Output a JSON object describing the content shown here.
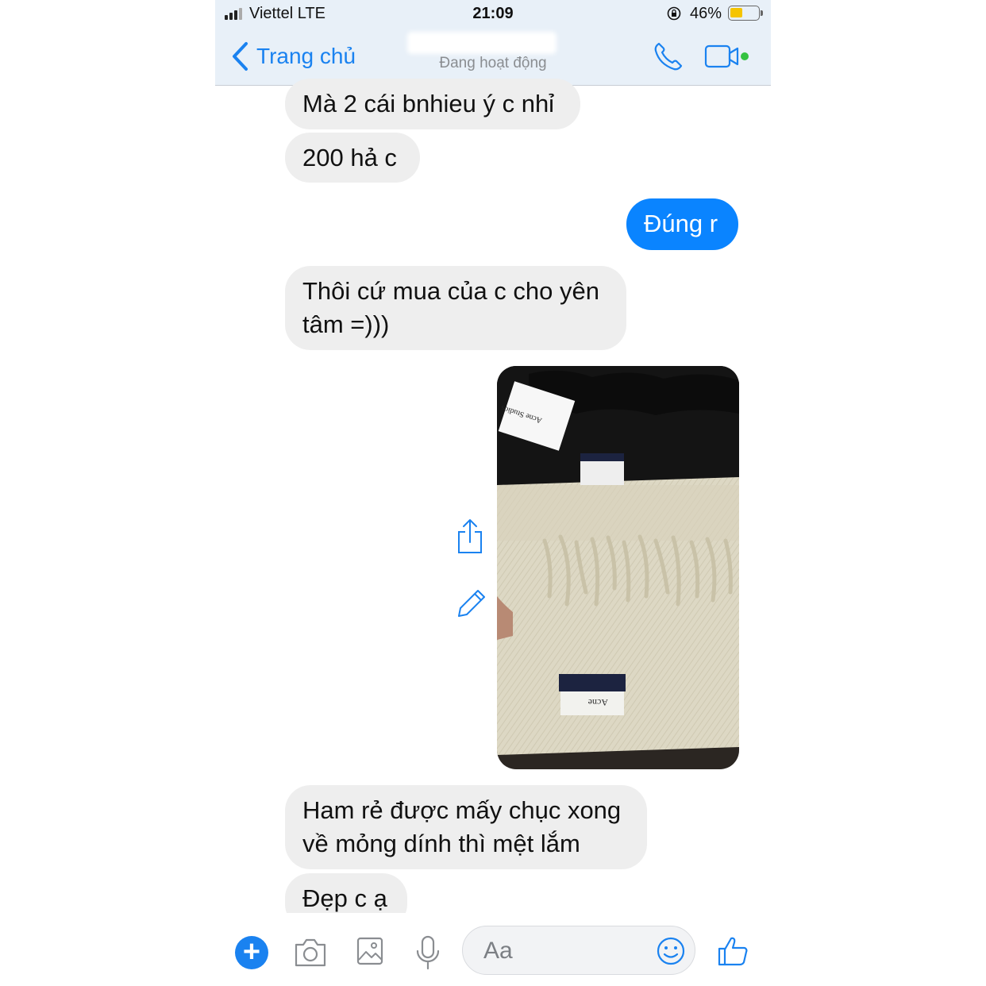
{
  "status_bar": {
    "carrier": "Viettel  LTE",
    "time": "21:09",
    "battery_percent_text": "46%",
    "battery_level": 0.46
  },
  "header": {
    "back_label": "Trang chủ",
    "presence": "Đang hoạt động"
  },
  "messages": [
    {
      "direction": "incoming",
      "text": "Mà 2 cái bnhieu ý c nhỉ"
    },
    {
      "direction": "incoming",
      "text": "200 hả c"
    },
    {
      "direction": "outgoing",
      "text": "Đúng r"
    },
    {
      "direction": "incoming",
      "text": "Thôi cứ mua của c cho yên tâm =)))"
    },
    {
      "direction": "outgoing",
      "type": "photo",
      "label_text": "Acne Studios"
    },
    {
      "direction": "incoming",
      "text": "Ham rẻ được mấy chục xong về mỏng dính thì mệt lắm"
    },
    {
      "direction": "incoming",
      "text": "Đẹp c ạ"
    }
  ],
  "composer": {
    "placeholder": "Aa"
  },
  "icons": [
    "signal-icon",
    "back-chevron-icon",
    "phone-icon",
    "video-icon",
    "share-icon",
    "edit-icon",
    "plus-icon",
    "camera-icon",
    "gallery-icon",
    "microphone-icon",
    "emoji-icon",
    "thumbs-up-icon"
  ],
  "colors": {
    "accent": "#1a82f0",
    "outgoing_bubble": "#0a84ff",
    "incoming_bubble": "#eeeeee",
    "header_bg": "#e8f0f8"
  }
}
